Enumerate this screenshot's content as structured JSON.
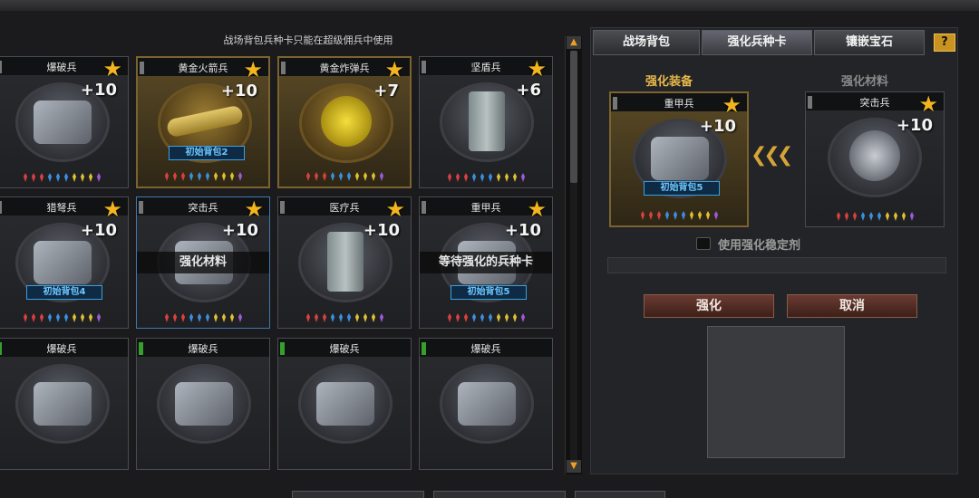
{
  "notice": "战场背包兵种卡只能在超级佣兵中使用",
  "cards": [
    {
      "name": "爆破兵",
      "level": "+10",
      "art": "box",
      "gold": false,
      "flag": "gray"
    },
    {
      "name": "黄金火箭兵",
      "level": "+10",
      "art": "rocket",
      "gold": true,
      "badge": "初始背包2",
      "flag": "gray"
    },
    {
      "name": "黄金炸弹兵",
      "level": "+7",
      "art": "round",
      "gold": true,
      "flag": "gray"
    },
    {
      "name": "坚盾兵",
      "level": "+6",
      "art": "tall",
      "gold": false,
      "flag": "gray"
    },
    {
      "name": "猎弩兵",
      "level": "+10",
      "art": "box",
      "gold": false,
      "badge": "初始背包4",
      "flag": "gray"
    },
    {
      "name": "突击兵",
      "level": "+10",
      "art": "box",
      "gold": false,
      "overlay": "强化材料",
      "selected": true,
      "flag": "gray"
    },
    {
      "name": "医疗兵",
      "level": "+10",
      "art": "tall",
      "gold": false,
      "flag": "gray"
    },
    {
      "name": "重甲兵",
      "level": "+10",
      "art": "box",
      "gold": false,
      "overlay": "等待强化的兵种卡",
      "badge": "初始背包5",
      "flag": "gray"
    },
    {
      "name": "爆破兵",
      "art": "box",
      "gold": false,
      "flag": "green"
    },
    {
      "name": "爆破兵",
      "art": "box",
      "gold": false,
      "flag": "green"
    },
    {
      "name": "爆破兵",
      "art": "box",
      "gold": false,
      "flag": "green"
    },
    {
      "name": "爆破兵",
      "art": "box",
      "gold": false,
      "flag": "green"
    }
  ],
  "gem_colors": [
    "#d94040",
    "#d94040",
    "#d94040",
    "#3b8fe0",
    "#3b8fe0",
    "#3b8fe0",
    "#e0c030",
    "#e0c030",
    "#e0c030",
    "#9b5bd6"
  ],
  "scroll": {
    "up": "▲",
    "down": "▼"
  },
  "tabs": [
    "战场背包",
    "强化兵种卡",
    "镶嵌宝石"
  ],
  "help_label": "?",
  "enhance": {
    "equip_label": "强化装备",
    "material_label": "强化材料",
    "equip_card": {
      "name": "重甲兵",
      "level": "+10",
      "badge": "初始背包5"
    },
    "material_card": {
      "name": "突击兵",
      "level": "+10"
    },
    "arrows": "❮❮❮",
    "stabilizer_label": "使用强化稳定剂",
    "enhance_button": "强化",
    "cancel_button": "取消"
  },
  "colors": {
    "gold": "#f2b51f",
    "equip_label": "#e7b84a",
    "material_label": "#8a8a8a",
    "badge": "#6cc6ff"
  }
}
